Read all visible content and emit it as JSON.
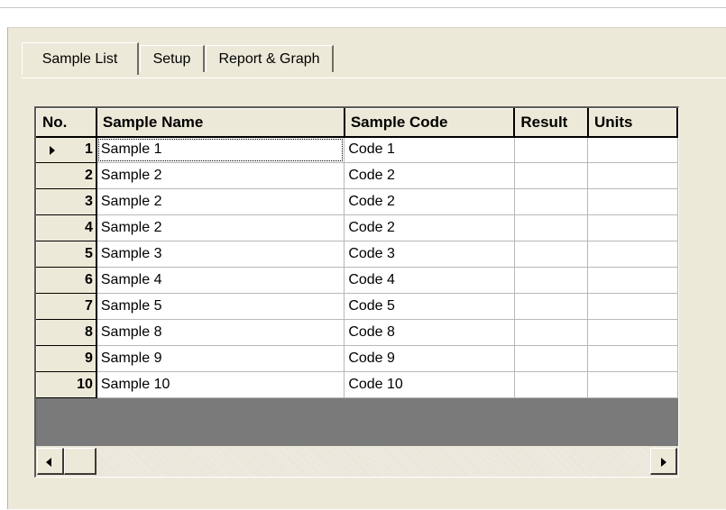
{
  "tabs": [
    {
      "label": "Sample List",
      "active": true
    },
    {
      "label": "Setup",
      "active": false
    },
    {
      "label": "Report & Graph",
      "active": false
    }
  ],
  "grid": {
    "columns": [
      "No.",
      "Sample Name",
      "Sample Code",
      "Result",
      "Units"
    ],
    "current_row": 1,
    "rows": [
      {
        "no": "1",
        "name": "Sample 1",
        "code": "Code 1",
        "result": "",
        "units": ""
      },
      {
        "no": "2",
        "name": "Sample 2",
        "code": "Code 2",
        "result": "",
        "units": ""
      },
      {
        "no": "3",
        "name": "Sample 2",
        "code": "Code 2",
        "result": "",
        "units": ""
      },
      {
        "no": "4",
        "name": "Sample 2",
        "code": "Code 2",
        "result": "",
        "units": ""
      },
      {
        "no": "5",
        "name": "Sample 3",
        "code": "Code 3",
        "result": "",
        "units": ""
      },
      {
        "no": "6",
        "name": "Sample 4",
        "code": "Code 4",
        "result": "",
        "units": ""
      },
      {
        "no": "7",
        "name": "Sample 5",
        "code": "Code 5",
        "result": "",
        "units": ""
      },
      {
        "no": "8",
        "name": "Sample 8",
        "code": "Code 8",
        "result": "",
        "units": ""
      },
      {
        "no": "9",
        "name": "Sample 9",
        "code": "Code 9",
        "result": "",
        "units": ""
      },
      {
        "no": "10",
        "name": "Sample 10",
        "code": "Code 10",
        "result": "",
        "units": ""
      }
    ]
  },
  "scrollbar": {
    "left_icon": "arrow-left-icon",
    "right_icon": "arrow-right-icon"
  },
  "colors": {
    "panel": "#ece9d8",
    "grid_empty": "#7a7a7a"
  }
}
